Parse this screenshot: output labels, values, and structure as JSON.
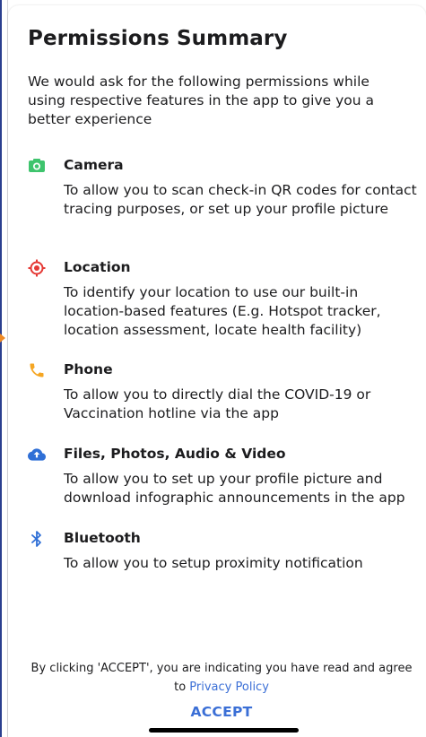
{
  "dialog": {
    "title": "Permissions Summary",
    "intro": "We would ask for the following permissions while using respective features in the app to give you a better experience"
  },
  "permissions": [
    {
      "icon": "camera-icon",
      "icon_color": "#3ec46d",
      "name": "Camera",
      "description": "To allow you to scan check-in QR codes for contact tracing purposes, or set up your profile picture"
    },
    {
      "icon": "location-target-icon",
      "icon_color": "#e53935",
      "name": "Location",
      "description": "To identify your location to use our built-in location-based features (E.g. Hotspot tracker, location assessment, locate health facility)"
    },
    {
      "icon": "phone-icon",
      "icon_color": "#f5a623",
      "name": "Phone",
      "description": "To allow you to directly dial the COVID-19 or Vaccination hotline via the app"
    },
    {
      "icon": "cloud-upload-icon",
      "icon_color": "#2f6fd6",
      "name": "Files, Photos, Audio & Video",
      "description": "To allow you to set up your profile picture and download infographic announcements in the app"
    },
    {
      "icon": "bluetooth-icon",
      "icon_color": "#2f6fd6",
      "name": "Bluetooth",
      "description": "To allow you to setup proximity notification"
    }
  ],
  "footer": {
    "consent_text": "By clicking 'ACCEPT', you are indicating you have read and agree to",
    "privacy_link": "Privacy Policy",
    "accept_label": "ACCEPT",
    "link_color": "#3b6fd6"
  }
}
